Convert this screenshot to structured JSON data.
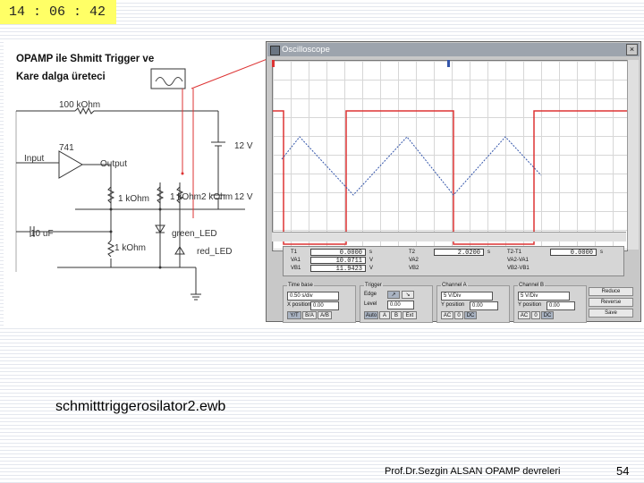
{
  "slide": {
    "clock": "14 : 06 : 42",
    "filename": "schmitttriggerosilator2.ewb",
    "footer": "Prof.Dr.Sezgin ALSAN OPAMP devreleri",
    "page_number": "54"
  },
  "circuit": {
    "title_line1": "OPAMP ile Shmitt Trigger ve",
    "title_line2": "Kare dalga üreteci",
    "labels": {
      "r100k": "100 kOhm",
      "v12_top": "12 V",
      "opamp": "741",
      "input": "Input",
      "output": "Output",
      "r1k_a": "1 kOhm",
      "r1k_b": "1 kOhm2 kOhm",
      "v12_bottom": "12 V",
      "cap": "10 uF",
      "green_led": "green_LED",
      "r1k_c": "1 kOhm",
      "red_led": "red_LED"
    }
  },
  "oscilloscope": {
    "title": "Oscilloscope",
    "close_glyph": "×",
    "readout": {
      "t1": {
        "label": "T1",
        "value": "0.0000",
        "unit": "s"
      },
      "va1": {
        "label": "VA1",
        "value": "10.0711",
        "unit": "V"
      },
      "vb1": {
        "label": "VB1",
        "value": "11.9423",
        "unit": "V"
      },
      "t2": {
        "label": "T2",
        "value": "2.0200",
        "unit": "s"
      },
      "va2": {
        "label": "VA2"
      },
      "vb2": {
        "label": "VB2"
      },
      "dt": {
        "label": "T2-T1",
        "value": "0.0000",
        "unit": "s"
      },
      "dva": {
        "label": "VA2-VA1"
      },
      "dvb": {
        "label": "VB2-VB1"
      }
    },
    "time_base": {
      "title": "Time base",
      "scale": "0.50 s/div",
      "xpos_label": "X position",
      "xpos": "0.00",
      "btn_yt": "Y/T",
      "btn_ba": "B/A",
      "btn_ab": "A/B"
    },
    "trigger": {
      "title": "Trigger",
      "edge_label": "Edge",
      "rising_glyph": "↗",
      "falling_glyph": "↘",
      "level_label": "Level",
      "level": "0.00",
      "btn_auto": "Auto",
      "btn_a": "A",
      "btn_b": "B",
      "btn_ext": "Ext"
    },
    "channel_a": {
      "title": "Channel A",
      "scale": "5 V/Div",
      "ypos_label": "Y position",
      "ypos": "0.00",
      "btn_ac": "AC",
      "btn_0": "0",
      "btn_dc": "DC"
    },
    "channel_b": {
      "title": "Channel B",
      "scale": "5 V/Div",
      "ypos_label": "Y position",
      "ypos": "0.00",
      "btn_ac": "AC",
      "btn_0": "0",
      "btn_dc": "DC"
    },
    "side_buttons": {
      "reduce": "Reduce",
      "reverse": "Reverse",
      "save": "Save"
    }
  }
}
